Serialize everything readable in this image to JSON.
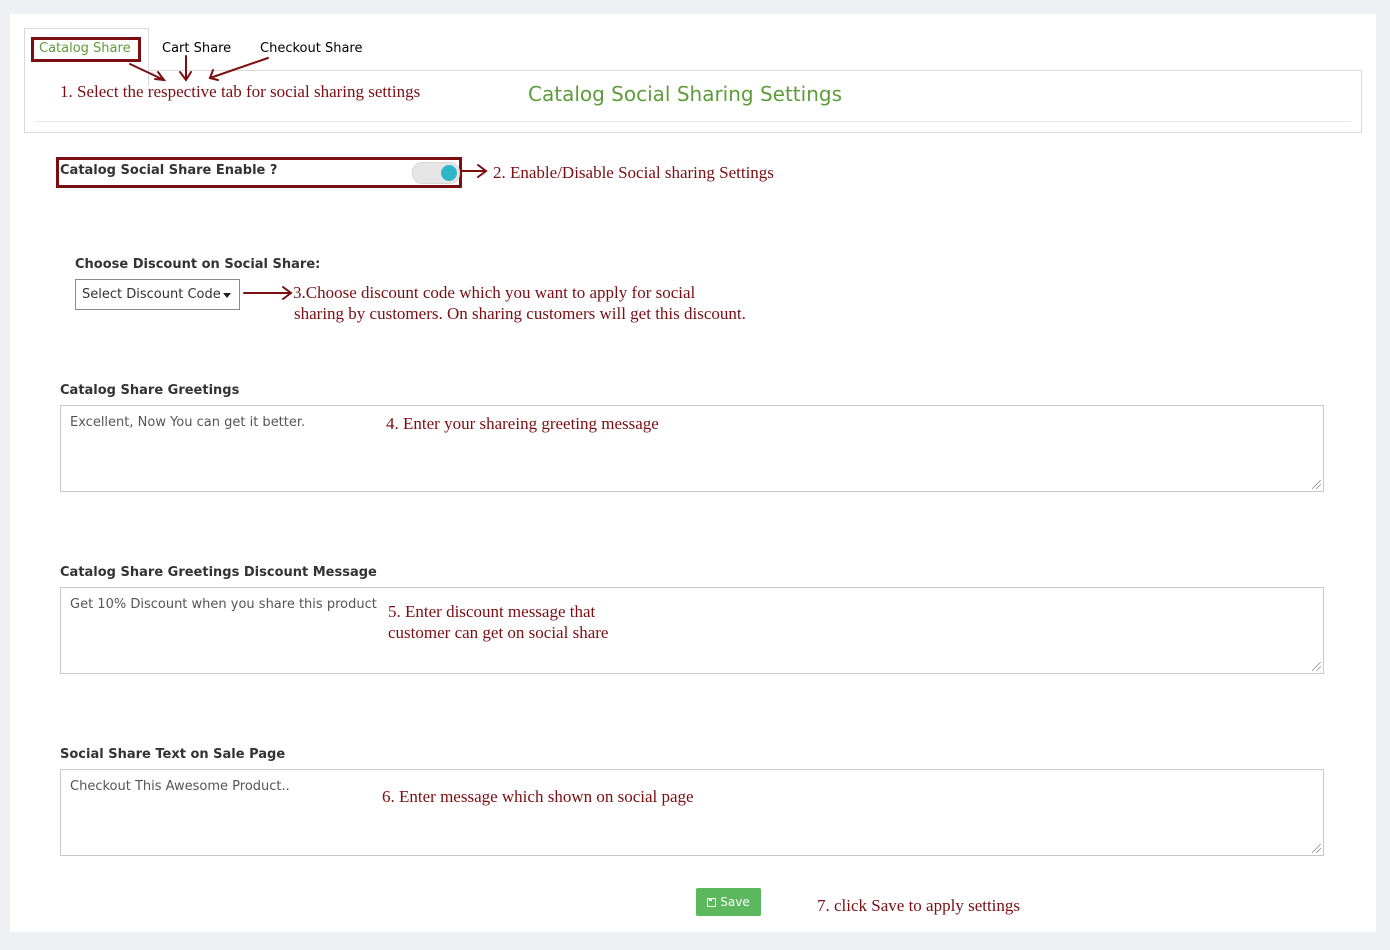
{
  "tabs": [
    {
      "label": "Catalog Share",
      "active": true
    },
    {
      "label": "Cart Share",
      "active": false
    },
    {
      "label": "Checkout Share",
      "active": false
    }
  ],
  "panel_title": "Catalog Social Sharing Settings",
  "enable_field": {
    "label": "Catalog Social Share Enable ?",
    "enabled": true
  },
  "discount": {
    "label": "Choose Discount on Social Share:",
    "selected": "Select Discount Code"
  },
  "greetings": {
    "label": "Catalog Share Greetings",
    "value": "Excellent, Now You can get it better."
  },
  "discount_message": {
    "label": "Catalog Share Greetings Discount Message",
    "value": "Get 10% Discount when you share this product"
  },
  "sale_page_text": {
    "label": "Social Share Text on Sale Page",
    "value": "Checkout This Awesome Product.."
  },
  "save_label": "Save",
  "annotations": {
    "a1": "1. Select the respective tab for social sharing settings",
    "a2": "2. Enable/Disable Social sharing Settings",
    "a3_line1": "3.Choose discount code which you want to apply for social",
    "a3_line2": "sharing by customers. On sharing customers will get this discount.",
    "a4": "4. Enter your shareing greeting message",
    "a5_line1": "5. Enter discount message that",
    "a5_line2": "customer can get on social share",
    "a6": "6. Enter message which shown on social page",
    "a7": "7. click Save to apply settings"
  },
  "colors": {
    "accent_green": "#5e9b3a",
    "annotation_red": "#7a0e12",
    "toggle_on": "#2fb4c8",
    "save_button": "#5cb85c"
  }
}
